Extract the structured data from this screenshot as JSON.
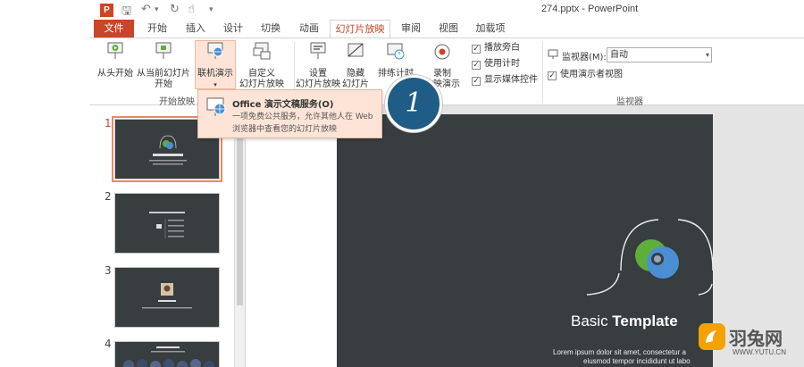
{
  "app": {
    "logo": "P",
    "document_title": "274.pptx - PowerPoint",
    "qat_icons": [
      "save-icon",
      "undo-icon",
      "redo-icon",
      "touch-mode-icon",
      "customize-icon"
    ]
  },
  "tabs": {
    "file": "文件",
    "items": [
      "开始",
      "插入",
      "设计",
      "切换",
      "动画",
      "幻灯片放映",
      "审阅",
      "视图",
      "加载项"
    ],
    "active": "幻灯片放映"
  },
  "ribbon": {
    "from_beginning": "从头开始",
    "from_current_l1": "从当前幻灯片",
    "from_current_l2": "开始",
    "present_online": "联机演示",
    "custom_show_l1": "自定义",
    "custom_show_l2": "幻灯片放映",
    "setup_l1": "设置",
    "setup_l2": "幻灯片放映",
    "hide_l1": "隐藏",
    "hide_l2": "幻灯片",
    "rehearse": "排练计时",
    "record_l1": "录制",
    "record_l2": "放映演示",
    "play_narrations": "播放旁白",
    "use_timings": "使用计时",
    "show_media_controls": "显示媒体控件",
    "group_start": "开始放映",
    "group_monitors": "监视器",
    "monitor_label": "监视器(M):",
    "monitor_value": "自动",
    "presenter_view": "使用演示者视图"
  },
  "dropdown": {
    "title": "Office 演示文稿服务(O)",
    "description": "一项免费公共服务，允许其他人在 Web 浏览器中查看您的幻灯片放映"
  },
  "callout": {
    "number": "1"
  },
  "slides": {
    "numbers": [
      "1",
      "2",
      "3",
      "4"
    ],
    "active": "1"
  },
  "slide": {
    "title_light": "Basic ",
    "title_bold": "Template",
    "body_line1": "Lorem ipsum dolor sit amet, consectetur a",
    "body_line2": "eiusmod tempor incididunt ut labo"
  },
  "watermark": {
    "brand": "羽兔网",
    "url": "WWW.YUTU.CN"
  },
  "colors": {
    "accent": "#c9452a",
    "slide_bg": "#383d3f",
    "callout": "#1f5c86",
    "dropdown_bg": "#fde4d7",
    "logo_green": "#5fae3b",
    "logo_blue": "#4a8fd4"
  }
}
